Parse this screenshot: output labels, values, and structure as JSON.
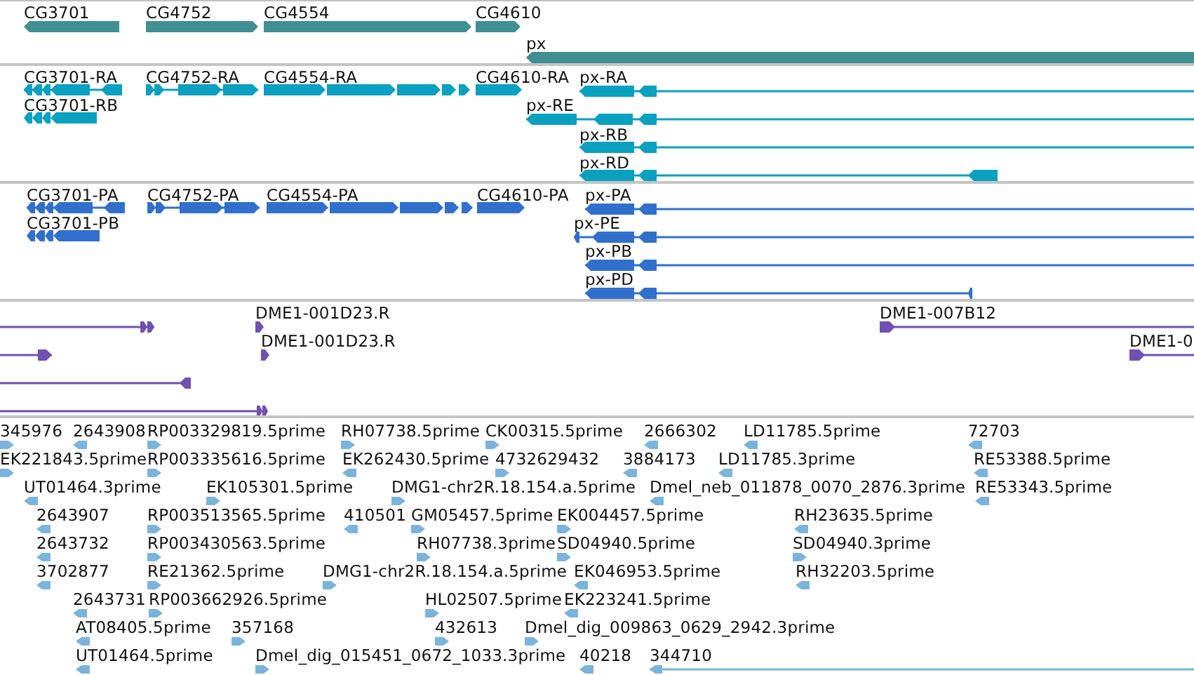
{
  "tracks": [
    {
      "kind": "gene",
      "features": [
        {
          "label": "CG3701"
        },
        {
          "label": "CG4752"
        },
        {
          "label": "CG4554"
        },
        {
          "label": "CG4610"
        },
        {
          "label": "px"
        }
      ]
    },
    {
      "kind": "transcript",
      "features": [
        {
          "label": "CG3701-RA"
        },
        {
          "label": "CG3701-RB"
        },
        {
          "label": "CG4752-RA"
        },
        {
          "label": "CG4554-RA"
        },
        {
          "label": "CG4610-RA"
        },
        {
          "label": "px-RA"
        },
        {
          "label": "px-RE"
        },
        {
          "label": "px-RB"
        },
        {
          "label": "px-RD"
        }
      ]
    },
    {
      "kind": "protein",
      "features": [
        {
          "label": "CG3701-PA"
        },
        {
          "label": "CG3701-PB"
        },
        {
          "label": "CG4752-PA"
        },
        {
          "label": "CG4554-PA"
        },
        {
          "label": "CG4610-PA"
        },
        {
          "label": "px-PA"
        },
        {
          "label": "px-PE"
        },
        {
          "label": "px-PB"
        },
        {
          "label": "px-PD"
        }
      ]
    },
    {
      "kind": "clone",
      "features": [
        {
          "label": "DME1-001D23.R"
        },
        {
          "label": "DME1-001D23.R"
        },
        {
          "label": "DME1-007B12"
        },
        {
          "label": "DME1-0"
        }
      ]
    },
    {
      "kind": "est",
      "features": [
        {
          "label": "345976"
        },
        {
          "label": "2643908"
        },
        {
          "label": "RP003329819.5prime"
        },
        {
          "label": "RH07738.5prime"
        },
        {
          "label": "CK00315.5prime"
        },
        {
          "label": "2666302"
        },
        {
          "label": "LD11785.5prime"
        },
        {
          "label": "72703"
        },
        {
          "label": "EK221843.5prime"
        },
        {
          "label": "RP003335616.5prime"
        },
        {
          "label": "EK262430.5prime"
        },
        {
          "label": "4732629432"
        },
        {
          "label": "3884173"
        },
        {
          "label": "LD11785.3prime"
        },
        {
          "label": "RE53388.5prime"
        },
        {
          "label": "UT01464.3prime"
        },
        {
          "label": "EK105301.5prime"
        },
        {
          "label": "DMG1-chr2R.18.154.a.5prime"
        },
        {
          "label": "Dmel_neb_011878_0070_2876.3prime"
        },
        {
          "label": "RE53343.5prime"
        },
        {
          "label": "2643907"
        },
        {
          "label": "RP003513565.5prime"
        },
        {
          "label": "410501"
        },
        {
          "label": "GM05457.5prime"
        },
        {
          "label": "EK004457.5prime"
        },
        {
          "label": "RH23635.5prime"
        },
        {
          "label": "2643732"
        },
        {
          "label": "RP003430563.5prime"
        },
        {
          "label": "RH07738.3prime"
        },
        {
          "label": "SD04940.5prime"
        },
        {
          "label": "SD04940.3prime"
        },
        {
          "label": "3702877"
        },
        {
          "label": "RE21362.5prime"
        },
        {
          "label": "DMG1-chr2R.18.154.a.5prime"
        },
        {
          "label": "EK046953.5prime"
        },
        {
          "label": "RH32203.5prime"
        },
        {
          "label": "2643731"
        },
        {
          "label": "RP003662926.5prime"
        },
        {
          "label": "HL02507.5prime"
        },
        {
          "label": "EK223241.5prime"
        },
        {
          "label": "AT08405.5prime"
        },
        {
          "label": "357168"
        },
        {
          "label": "432613"
        },
        {
          "label": "Dmel_dig_009863_0629_2942.3prime"
        },
        {
          "label": "UT01464.5prime"
        },
        {
          "label": "Dmel_dig_015451_0672_1033.3prime"
        },
        {
          "label": "40218"
        },
        {
          "label": "344710"
        }
      ]
    }
  ]
}
